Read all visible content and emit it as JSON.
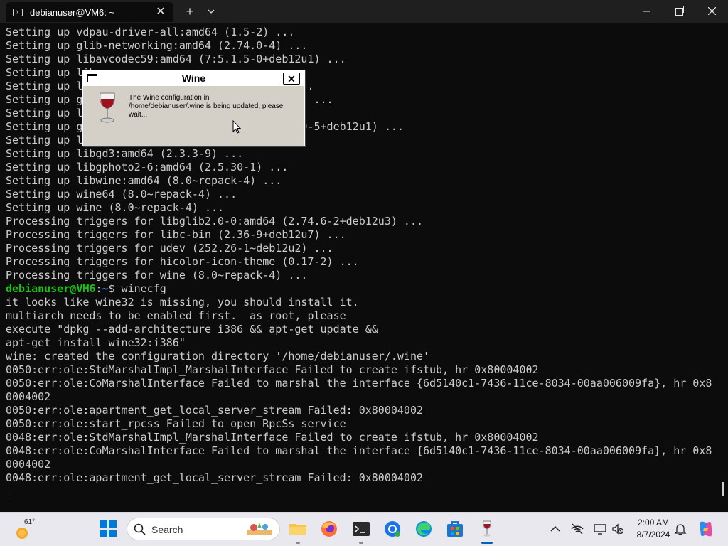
{
  "window": {
    "tab_title": "debianuser@VM6: ~",
    "tab_close": "✕",
    "new_tab": "+",
    "dropdown": "⌄",
    "minimize": "—",
    "close": "✕"
  },
  "terminal": {
    "lines_before_prompt": [
      "Setting up vdpau-driver-all:amd64 (1.5-2) ...",
      "Setting up glib-networking:amd64 (2.74.0-4) ...",
      "Setting up libavcodec59:amd64 (7:5.1.5-0+deb12u1) ...",
      "Setting up libxxxxxxxxxxxxxxxxxxxxxxxxxxxx ...",
      "Setting up libxxxxxxxxxxxxxxxxxxxxxxxxxxxxxx ...",
      "Setting up gxxxxxxxxxxxxxxxxxxxxxxxxxxxxxxx2u2) ...",
      "Setting up libxxxxxxxxxxxxxxxxxxx",
      "Setting up gxxxxxxxxxxxxxxxxxxxxxxxxxxxxxxxx2.0-5+deb12u1) ...",
      "Setting up libxxxxxxxxxxxxxxxxxxxxxxxxxxx ...",
      "Setting up libgd3:amd64 (2.3.3-9) ...",
      "Setting up libgphoto2-6:amd64 (2.5.30-1) ...",
      "Setting up libwine:amd64 (8.0~repack-4) ...",
      "Setting up wine64 (8.0~repack-4) ...",
      "Setting up wine (8.0~repack-4) ...",
      "Processing triggers for libglib2.0-0:amd64 (2.74.6-2+deb12u3) ...",
      "Processing triggers for libc-bin (2.36-9+deb12u7) ...",
      "Processing triggers for udev (252.26-1~deb12u2) ...",
      "Processing triggers for hicolor-icon-theme (0.17-2) ...",
      "Processing triggers for wine (8.0~repack-4) ..."
    ],
    "prompt_user": "debianuser@VM6",
    "prompt_sep": ":",
    "prompt_path": "~",
    "prompt_cmd": "$ winecfg",
    "lines_after_prompt": [
      "it looks like wine32 is missing, you should install it.",
      "multiarch needs to be enabled first.  as root, please",
      "execute \"dpkg --add-architecture i386 && apt-get update &&",
      "apt-get install wine32:i386\"",
      "wine: created the configuration directory '/home/debianuser/.wine'",
      "0050:err:ole:StdMarshalImpl_MarshalInterface Failed to create ifstub, hr 0x80004002",
      "0050:err:ole:CoMarshalInterface Failed to marshal the interface {6d5140c1-7436-11ce-8034-00aa006009fa}, hr 0x8",
      "0004002",
      "0050:err:ole:apartment_get_local_server_stream Failed: 0x80004002",
      "0050:err:ole:start_rpcss Failed to open RpcSs service",
      "0048:err:ole:StdMarshalImpl_MarshalInterface Failed to create ifstub, hr 0x80004002",
      "0048:err:ole:CoMarshalInterface Failed to marshal the interface {6d5140c1-7436-11ce-8034-00aa006009fa}, hr 0x8",
      "0004002",
      "0048:err:ole:apartment_get_local_server_stream Failed: 0x80004002"
    ]
  },
  "wine_dialog": {
    "title": "Wine",
    "close": "✕",
    "message": "The Wine configuration in /home/debianuser/.wine is being updated, please wait..."
  },
  "taskbar": {
    "weather_temp": "61°",
    "search_placeholder": "Search",
    "clock_time": "2:00 AM",
    "clock_date": "8/7/2024"
  },
  "colors": {
    "terminal_bg": "#0c0c0c",
    "terminal_fg": "#cccccc",
    "prompt_user": "#16c60c",
    "prompt_path": "#3b78ff",
    "dialog_bg": "#d4d0c8",
    "taskbar_bg": "#e8e8ee"
  }
}
